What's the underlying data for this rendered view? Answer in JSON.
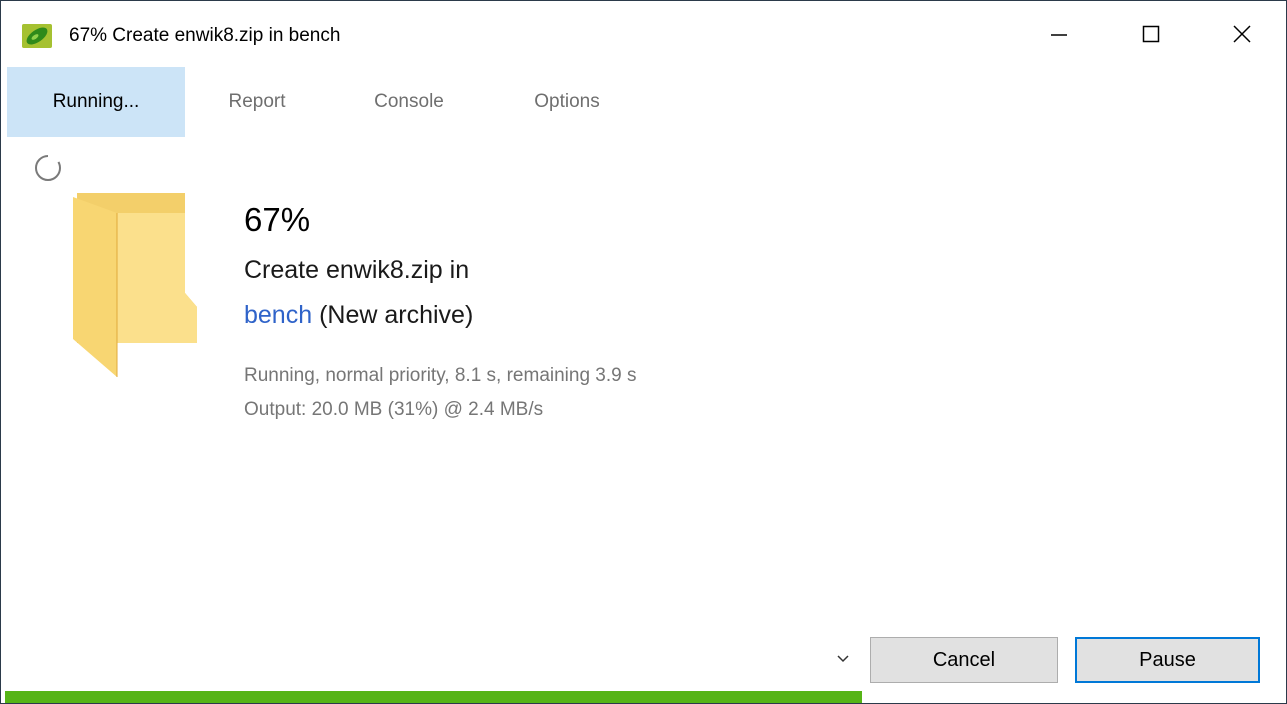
{
  "window": {
    "title": "67% Create enwik8.zip in bench",
    "controls": {
      "minimize": "minimize",
      "maximize": "maximize",
      "close": "close"
    }
  },
  "tabs": [
    {
      "label": "Running...",
      "active": true
    },
    {
      "label": "Report",
      "active": false
    },
    {
      "label": "Console",
      "active": false
    },
    {
      "label": "Options",
      "active": false
    }
  ],
  "task": {
    "percent_label": "67%",
    "action_text": "Create enwik8.zip in",
    "destination_link": "bench",
    "destination_note": "(New archive)",
    "status_text": "Running, normal priority, 8.1 s, remaining 3.9 s",
    "output_text": "Output: 20.0 MB (31%) @ 2.4 MB/s"
  },
  "buttons": {
    "cancel_label": "Cancel",
    "pause_label": "Pause"
  },
  "progress": {
    "fraction": 0.67,
    "color": "#56b416"
  },
  "colors": {
    "active_tab": "#cce4f7",
    "link": "#2f63c9",
    "focus_border": "#0078d7"
  },
  "icons": {
    "app": "peazip-icon",
    "spinner": "loading-spinner-icon",
    "folder": "folder-icon",
    "more": "chevron-down-icon"
  }
}
